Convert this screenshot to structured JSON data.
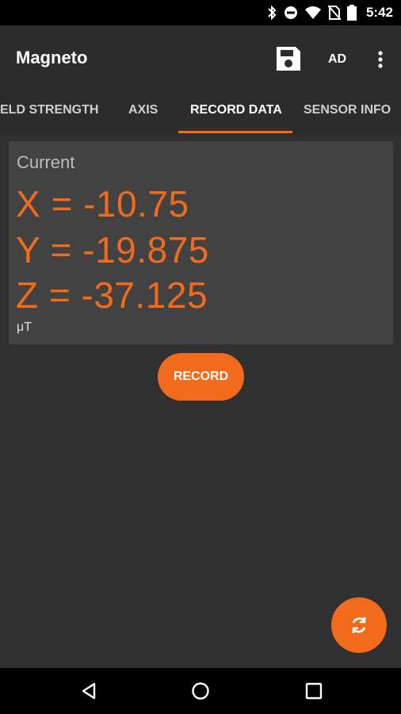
{
  "status_bar": {
    "time": "5:42",
    "icons": [
      "bluetooth-icon",
      "do-not-disturb-icon",
      "wifi-icon",
      "no-sim-icon",
      "battery-icon"
    ]
  },
  "app_bar": {
    "title": "Magneto",
    "save_icon": "save-icon",
    "ad_label": "AD",
    "more_icon": "more-vert-icon"
  },
  "tabs": [
    {
      "label": "ELD STRENGTH",
      "active": false
    },
    {
      "label": "AXIS",
      "active": false
    },
    {
      "label": "RECORD DATA",
      "active": true
    },
    {
      "label": "SENSOR INFO",
      "active": false
    }
  ],
  "reading": {
    "label": "Current",
    "x": "X = -10.75",
    "y": "Y = -19.875",
    "z": "Z = -37.125",
    "unit": "μT"
  },
  "record_button": "RECORD",
  "fab_icon": "refresh-icon",
  "colors": {
    "accent": "#f26b1d",
    "background": "#303030",
    "card": "#424242"
  },
  "nav_bar": [
    "back-icon",
    "home-icon",
    "recents-icon"
  ]
}
